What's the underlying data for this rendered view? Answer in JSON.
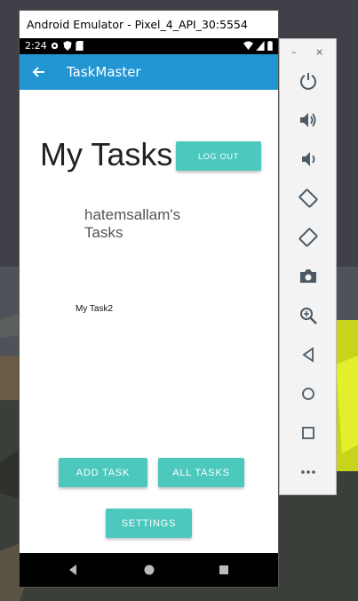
{
  "emulator": {
    "window_title": "Android Emulator - Pixel_4_API_30:5554",
    "panel_minimize": "–",
    "panel_close": "×"
  },
  "status_bar": {
    "time": "2:24"
  },
  "app": {
    "title": "TaskMaster",
    "heading": "My Tasks",
    "logout_label": "LOG OUT",
    "user_tasks_label": "hatemsallam's Tasks",
    "tasks": [
      "My Task2"
    ],
    "add_task_label": "ADD TASK",
    "all_tasks_label": "ALL TASKS",
    "settings_label": "SETTINGS"
  },
  "colors": {
    "app_bar": "#2196d3",
    "button": "#4cc8bd",
    "nav_bar": "#000000"
  },
  "side_panel_icons": [
    "power-icon",
    "volume-up-icon",
    "volume-down-icon",
    "rotate-left-icon",
    "rotate-right-icon",
    "camera-icon",
    "zoom-icon",
    "back-icon",
    "home-icon",
    "overview-icon",
    "more-icon"
  ]
}
